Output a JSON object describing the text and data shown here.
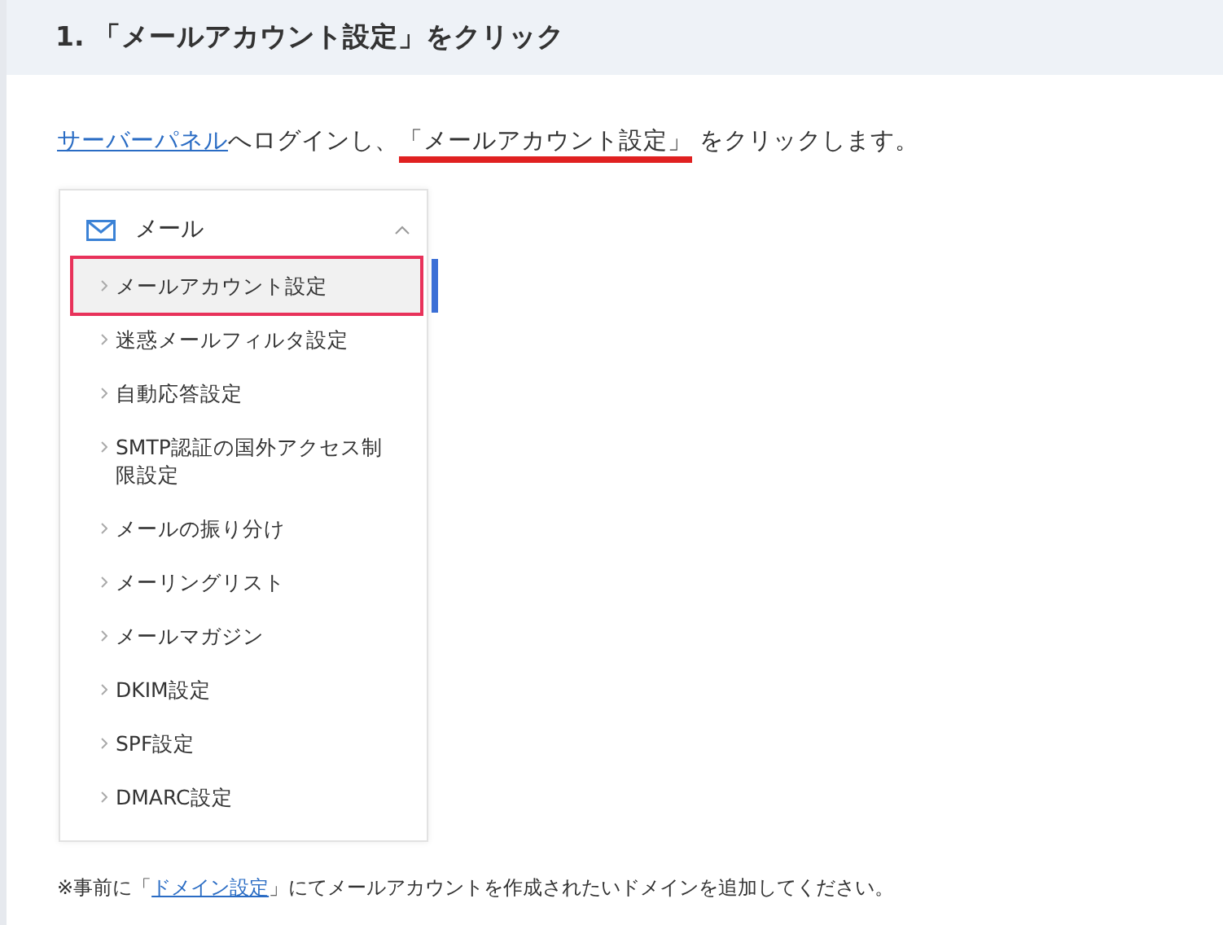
{
  "heading": "1. 「メールアカウント設定」をクリック",
  "intro": {
    "link": "サーバーパネル",
    "text_1": "へログインし、",
    "highlight": "「メールアカウント設定」",
    "text_2": "をクリックします。"
  },
  "menu": {
    "title": "メール",
    "expanded": true,
    "items": [
      {
        "label": "メールアカウント設定",
        "selected": true,
        "annotated": true
      },
      {
        "label": "迷惑メールフィルタ設定",
        "selected": false,
        "annotated": false
      },
      {
        "label": "自動応答設定",
        "selected": false,
        "annotated": false
      },
      {
        "label": "SMTP認証の国外アクセス制限設定",
        "selected": false,
        "annotated": false
      },
      {
        "label": "メールの振り分け",
        "selected": false,
        "annotated": false
      },
      {
        "label": "メーリングリスト",
        "selected": false,
        "annotated": false
      },
      {
        "label": "メールマガジン",
        "selected": false,
        "annotated": false
      },
      {
        "label": "DKIM設定",
        "selected": false,
        "annotated": false
      },
      {
        "label": "SPF設定",
        "selected": false,
        "annotated": false
      },
      {
        "label": "DMARC設定",
        "selected": false,
        "annotated": false
      }
    ]
  },
  "note": {
    "text_1": "※事前に「",
    "link": "ドメイン設定",
    "text_2": "」にてメールアカウントを作成されたいドメインを追加してください。"
  }
}
